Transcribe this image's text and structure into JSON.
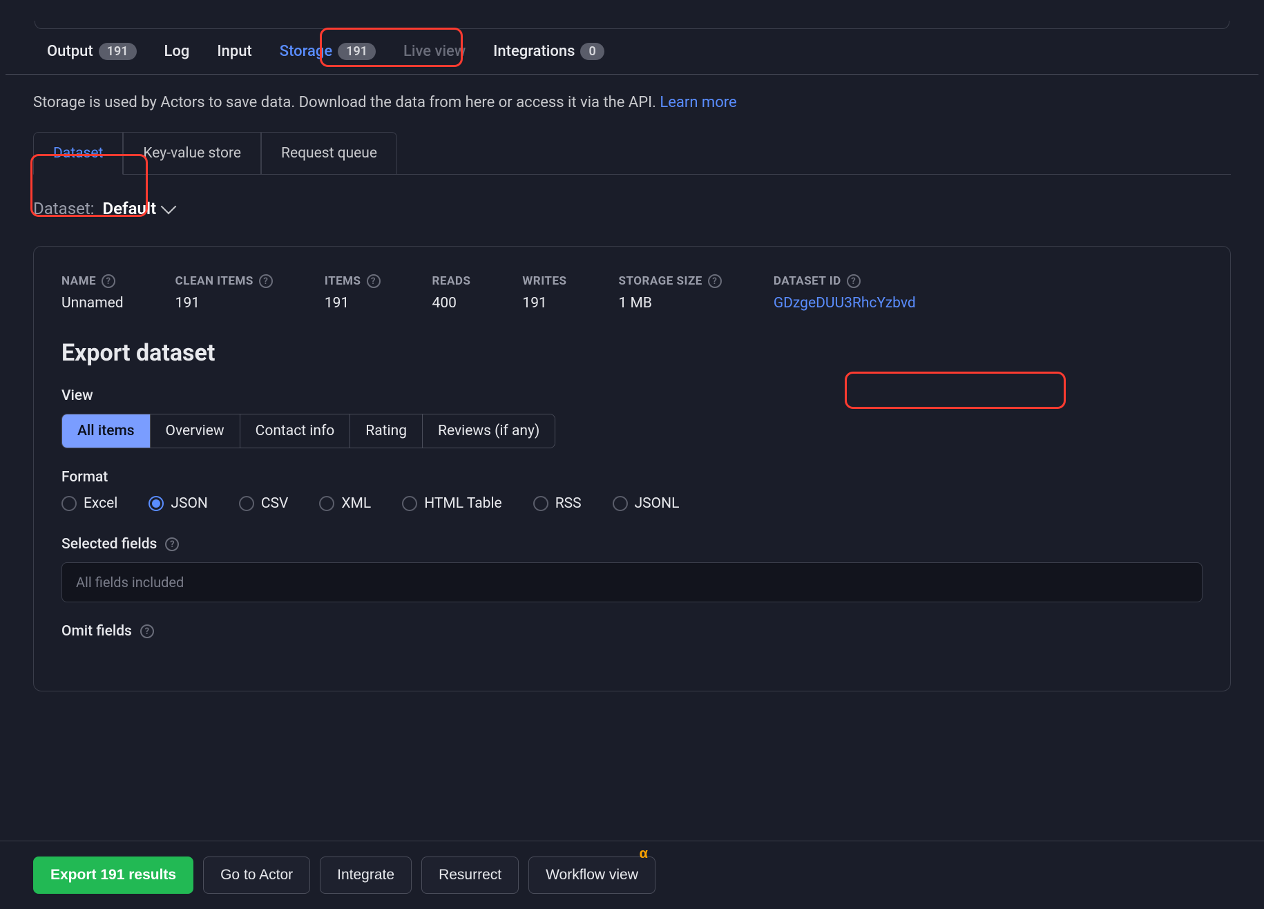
{
  "tabs": {
    "output": {
      "label": "Output",
      "badge": "191"
    },
    "log": {
      "label": "Log"
    },
    "input": {
      "label": "Input"
    },
    "storage": {
      "label": "Storage",
      "badge": "191"
    },
    "live_view": {
      "label": "Live view"
    },
    "integrations": {
      "label": "Integrations",
      "badge": "0"
    }
  },
  "intro": {
    "text": "Storage is used by Actors to save data. Download the data from here or access it via the API. ",
    "link": "Learn more"
  },
  "sub_tabs": {
    "dataset": "Dataset",
    "kv": "Key-value store",
    "rq": "Request queue"
  },
  "selector": {
    "label": "Dataset:",
    "value": "Default"
  },
  "meta": {
    "name": {
      "label": "NAME",
      "value": "Unnamed"
    },
    "clean_items": {
      "label": "CLEAN ITEMS",
      "value": "191"
    },
    "items": {
      "label": "ITEMS",
      "value": "191"
    },
    "reads": {
      "label": "READS",
      "value": "400"
    },
    "writes": {
      "label": "WRITES",
      "value": "191"
    },
    "storage_size": {
      "label": "STORAGE SIZE",
      "value": "1 MB"
    },
    "dataset_id": {
      "label": "DATASET ID",
      "value": "GDzgeDUU3RhcYzbvd"
    }
  },
  "export": {
    "heading": "Export dataset",
    "view_label": "View",
    "view_tabs": [
      "All items",
      "Overview",
      "Contact info",
      "Rating",
      "Reviews (if any)"
    ],
    "format_label": "Format",
    "formats": [
      "Excel",
      "JSON",
      "CSV",
      "XML",
      "HTML Table",
      "RSS",
      "JSONL"
    ],
    "format_selected": "JSON",
    "selected_fields_label": "Selected fields",
    "selected_fields_placeholder": "All fields included",
    "omit_fields_label": "Omit fields"
  },
  "bottom": {
    "export": "Export 191 results",
    "go_to_actor": "Go to Actor",
    "integrate": "Integrate",
    "resurrect": "Resurrect",
    "workflow": "Workflow view",
    "alpha": "α"
  }
}
